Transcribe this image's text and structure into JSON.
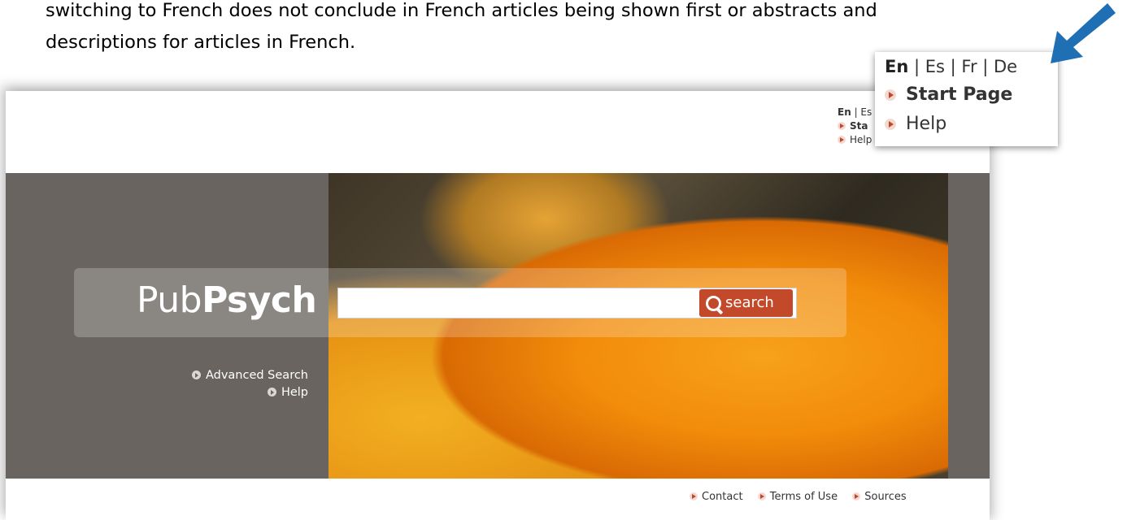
{
  "document": {
    "line1": "switching to French does not conclude in French articles being shown first or abstracts and",
    "line2": "descriptions for articles in French."
  },
  "header": {
    "languages": {
      "current": "En",
      "others": [
        "Es",
        "Fr",
        "De"
      ],
      "separator": "|"
    },
    "start_page_label": "Start Page",
    "help_label": "Help",
    "cropped_lang_text": "En | Es",
    "cropped_start_text": "Sta"
  },
  "search": {
    "logo_light": "Pub",
    "logo_bold": "Psych",
    "button_label": "search",
    "input_value": "",
    "advanced_label": "Advanced Search",
    "help_label": "Help"
  },
  "footer": {
    "links": [
      "Contact",
      "Terms of Use",
      "Sources"
    ]
  },
  "colors": {
    "banner": "#69645f",
    "search_button": "#c24a2b",
    "arrow_accent": "#c2462d",
    "pointer_arrow": "#1e6fb3"
  },
  "icons": {
    "bullet": "arrow-right-icon",
    "circle_bullet": "circle-arrow-icon",
    "search": "magnifier-icon",
    "pointer": "blue-pointer-arrow"
  }
}
